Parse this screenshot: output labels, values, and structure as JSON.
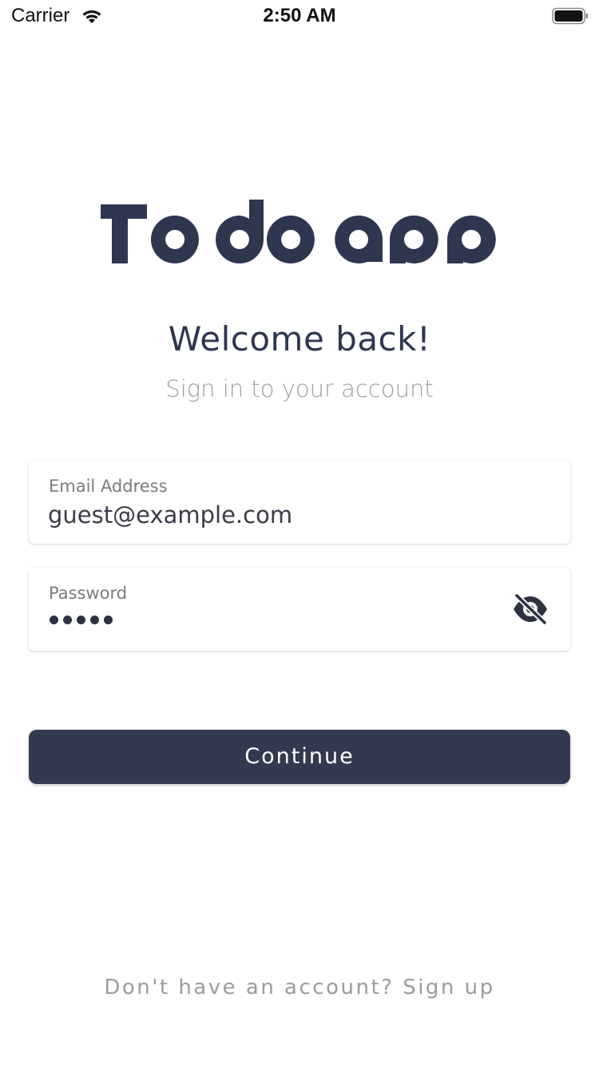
{
  "status_bar": {
    "carrier": "Carrier",
    "time": "2:50 AM",
    "wifi_icon": "wifi-icon",
    "battery_icon": "battery-icon"
  },
  "logo": {
    "text": "Todo app",
    "color": "#2f3650"
  },
  "header": {
    "title": "Welcome back!",
    "subtitle": "Sign in to your account"
  },
  "form": {
    "email": {
      "label": "Email Address",
      "value": "guest@example.com"
    },
    "password": {
      "label": "Password",
      "masked_length": 5,
      "toggle_icon": "eye-off-icon"
    },
    "continue_label": "Continue"
  },
  "footer": {
    "signup_text": "Don't have an account? Sign up"
  },
  "colors": {
    "primary": "#333a4f",
    "muted_text": "#a0a0a4",
    "background": "#ffffff"
  }
}
